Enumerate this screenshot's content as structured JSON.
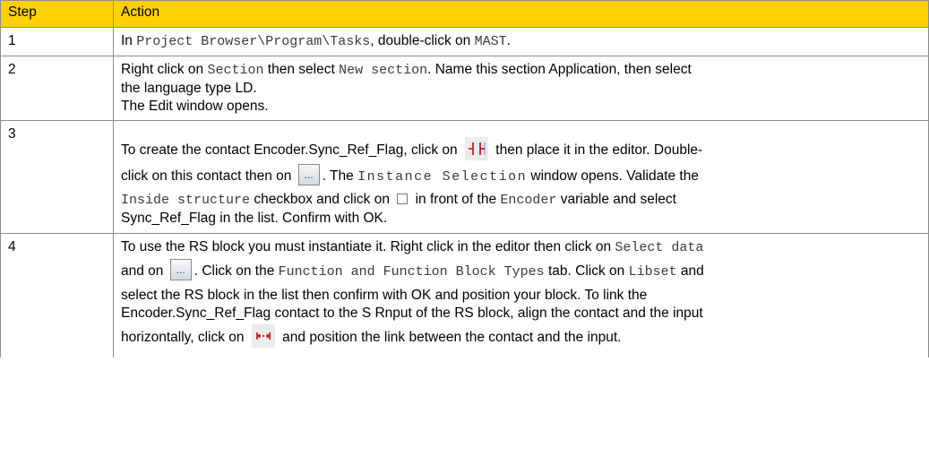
{
  "table": {
    "headers": {
      "step": "Step",
      "action": "Action"
    },
    "rows": [
      {
        "step": "1",
        "t1": "In ",
        "m1": "Project Browser\\Program\\Tasks",
        "t2": ", double-click on ",
        "m2": "MAST",
        "t3": "."
      },
      {
        "step": "2",
        "t1": "Right click on ",
        "m1": "Section",
        "t2": " then select ",
        "m2": "New section",
        "t3": ". Name this section Application, then select",
        "t4": "the language type LD.",
        "t5": "The Edit window opens."
      },
      {
        "step": "3",
        "t1": "To create the contact Encoder.Sync_Ref_Flag, click on ",
        "t2": " then place it in the editor. Double-",
        "t3": "click on this contact then on ",
        "t4": ". The ",
        "m1": "Instance Selection",
        "t5": " window opens. Validate the",
        "m2": "Inside structure",
        "t6": " checkbox and click on ",
        "t7": " in front of the ",
        "m3": "Encoder",
        "t8": " variable and select",
        "t9": "Sync_Ref_Flag in the list. Confirm with OK."
      },
      {
        "step": "4",
        "t1": "To use the RS block you must instantiate it. Right click in the editor then click on ",
        "m1": "Select data",
        "t2": "and on ",
        "t3": ". Click on the ",
        "m2": "Function and Function Block Types",
        "t4": " tab. Click on ",
        "m3": "Libset",
        "t5": " and",
        "t6": "select the RS block in the list then confirm with OK and position your block. To link the",
        "t7": "Encoder.Sync_Ref_Flag contact to the S Rnput of the RS block, align the contact and the input",
        "t8": "horizontally, click on ",
        "t9": " and position the link between the contact and the input."
      }
    ]
  },
  "icons": {
    "browse_button_label": "...",
    "contact_icon": "ld-contact-icon",
    "link_icon": "ld-link-icon",
    "checkbox_icon": "expand-checkbox-icon"
  },
  "colors": {
    "header_background": "#ffd105",
    "border": "#8c8c8c"
  }
}
